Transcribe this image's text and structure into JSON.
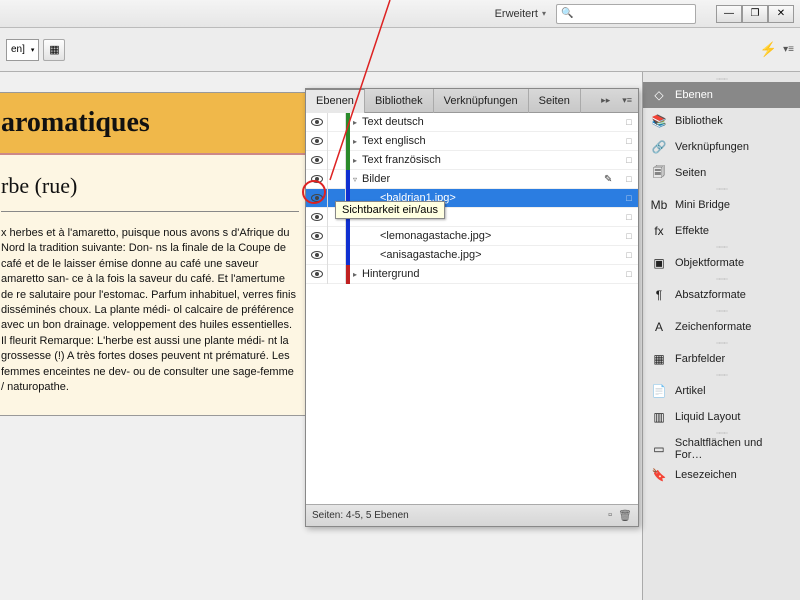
{
  "titlebar": {
    "mode": "Erweitert",
    "search_placeholder": "🔍",
    "win": {
      "min": "—",
      "max": "❐",
      "close": "✕"
    }
  },
  "toolbar": {
    "dropdown": "en]",
    "bolt": "⚡"
  },
  "document": {
    "header": "aromatiques",
    "subhead": "rbe (rue)",
    "body": "x herbes et à l'amaretto, puisque nous avons s d'Afrique du Nord la tradition suivante: Don- ns la finale de la Coupe de café et de le laisser émise donne au café une saveur amaretto san- ce à la fois la saveur du café. Et l'amertume de re salutaire pour l'estomac. Parfum inhabituel, verres finis disséminés choux. La plante médi- ol calcaire de préférence avec un bon drainage. veloppement des huiles essentielles. Il fleurit Remarque: L'herbe est aussi une plante médi- nt la grossesse (!) A très fortes doses peuvent nt prématuré. Les femmes enceintes ne dev- ou de consulter une sage-femme / naturopathe."
  },
  "layers_panel": {
    "tabs": [
      "Ebenen",
      "Bibliothek",
      "Verknüpfungen",
      "Seiten"
    ],
    "rows": [
      {
        "name": "Text deutsch",
        "color": "#2a8a2a",
        "indent": 0,
        "disclose": "▸"
      },
      {
        "name": "Text englisch",
        "color": "#2a8a2a",
        "indent": 0,
        "disclose": "▸"
      },
      {
        "name": "Text französisch",
        "color": "#2a8a2a",
        "indent": 0,
        "disclose": "▸"
      },
      {
        "name": "Bilder",
        "color": "#1030d0",
        "indent": 0,
        "disclose": "▿",
        "pen": true
      },
      {
        "name": "<baldrian1.jpg>",
        "color": "#1030d0",
        "indent": 1,
        "selected": true
      },
      {
        "name": "",
        "color": "#1030d0",
        "indent": 1,
        "tooltip_cover": true
      },
      {
        "name": "<lemonagastache.jpg>",
        "color": "#1030d0",
        "indent": 1
      },
      {
        "name": "<anisagastache.jpg>",
        "color": "#1030d0",
        "indent": 1
      },
      {
        "name": "Hintergrund",
        "color": "#c02020",
        "indent": 0,
        "disclose": "▸"
      }
    ],
    "tooltip": "Sichtbarkeit ein/aus",
    "status": "Seiten: 4-5, 5 Ebenen"
  },
  "right_dock": {
    "groups": [
      [
        {
          "label": "Ebenen",
          "icon": "◇",
          "active": true
        },
        {
          "label": "Bibliothek",
          "icon": "📚"
        },
        {
          "label": "Verknüpfungen",
          "icon": "🔗"
        },
        {
          "label": "Seiten",
          "icon": "🗐"
        }
      ],
      [
        {
          "label": "Mini Bridge",
          "icon": "Mb"
        },
        {
          "label": "Effekte",
          "icon": "fx"
        }
      ],
      [
        {
          "label": "Objektformate",
          "icon": "▣"
        }
      ],
      [
        {
          "label": "Absatzformate",
          "icon": "¶"
        }
      ],
      [
        {
          "label": "Zeichenformate",
          "icon": "A"
        }
      ],
      [
        {
          "label": "Farbfelder",
          "icon": "▦"
        }
      ],
      [
        {
          "label": "Artikel",
          "icon": "📄"
        },
        {
          "label": "Liquid Layout",
          "icon": "▥"
        }
      ],
      [
        {
          "label": "Schaltflächen und For…",
          "icon": "▭"
        },
        {
          "label": "Lesezeichen",
          "icon": "🔖"
        }
      ]
    ]
  }
}
